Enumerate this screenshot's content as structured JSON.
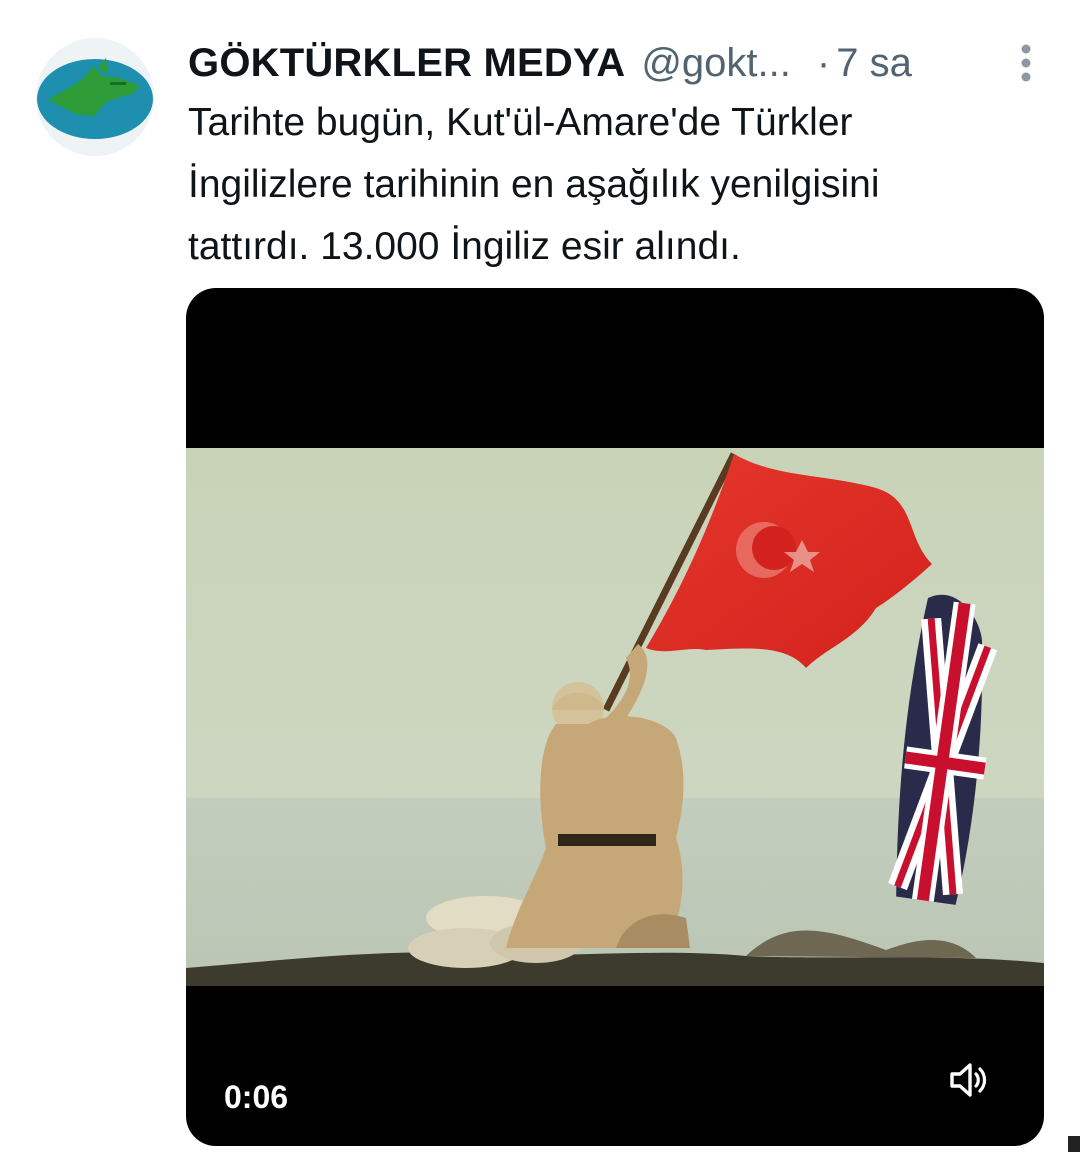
{
  "tweet": {
    "author": {
      "display_name": "GÖKTÜRKLER MEDYA",
      "handle": "@gokt...",
      "avatar_icon": "wolf-head-avatar"
    },
    "separator": "·",
    "time": "7 sa",
    "text_lines": [
      "Tarihte bugün, Kut'ül-Amare'de Türkler",
      "İngilizlere tarihinin en aşağılık yenilgisini",
      "tattırdı. 13.000 İngiliz esir alındı."
    ],
    "media": {
      "type": "video",
      "duration": "0:06",
      "mute_icon": "speaker-muted-icon",
      "scene": "Soldier raising a red Turkish flag next to a Union Jack"
    },
    "more_icon": "more-vertical-icon"
  },
  "colors": {
    "text_primary": "#0f1419",
    "text_secondary": "#536471",
    "media_bg": "#000000",
    "avatar_teal": "#1e8fae",
    "avatar_green": "#2e9d38"
  }
}
